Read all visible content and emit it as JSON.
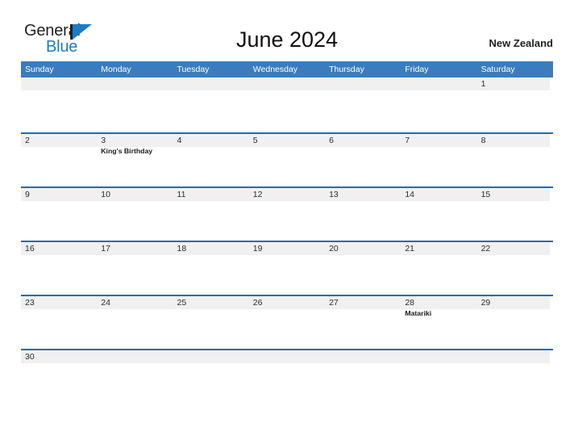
{
  "brand": {
    "name_part1": "General",
    "name_part2": "Blue",
    "triangle_color": "#1a7dc4"
  },
  "header": {
    "title": "June 2024",
    "country": "New Zealand"
  },
  "colors": {
    "header_bar": "#3a7cbe",
    "row_divider": "#1f6cb0",
    "date_band": "#f0f0f0",
    "page_background": "#ffffff"
  },
  "calendar": {
    "weekday_headers": [
      "Sunday",
      "Monday",
      "Tuesday",
      "Wednesday",
      "Thursday",
      "Friday",
      "Saturday"
    ],
    "weeks": [
      {
        "days": [
          {
            "num": "",
            "event": ""
          },
          {
            "num": "",
            "event": ""
          },
          {
            "num": "",
            "event": ""
          },
          {
            "num": "",
            "event": ""
          },
          {
            "num": "",
            "event": ""
          },
          {
            "num": "",
            "event": ""
          },
          {
            "num": "1",
            "event": ""
          }
        ]
      },
      {
        "days": [
          {
            "num": "2",
            "event": ""
          },
          {
            "num": "3",
            "event": "King's Birthday"
          },
          {
            "num": "4",
            "event": ""
          },
          {
            "num": "5",
            "event": ""
          },
          {
            "num": "6",
            "event": ""
          },
          {
            "num": "7",
            "event": ""
          },
          {
            "num": "8",
            "event": ""
          }
        ]
      },
      {
        "days": [
          {
            "num": "9",
            "event": ""
          },
          {
            "num": "10",
            "event": ""
          },
          {
            "num": "11",
            "event": ""
          },
          {
            "num": "12",
            "event": ""
          },
          {
            "num": "13",
            "event": ""
          },
          {
            "num": "14",
            "event": ""
          },
          {
            "num": "15",
            "event": ""
          }
        ]
      },
      {
        "days": [
          {
            "num": "16",
            "event": ""
          },
          {
            "num": "17",
            "event": ""
          },
          {
            "num": "18",
            "event": ""
          },
          {
            "num": "19",
            "event": ""
          },
          {
            "num": "20",
            "event": ""
          },
          {
            "num": "21",
            "event": ""
          },
          {
            "num": "22",
            "event": ""
          }
        ]
      },
      {
        "days": [
          {
            "num": "23",
            "event": ""
          },
          {
            "num": "24",
            "event": ""
          },
          {
            "num": "25",
            "event": ""
          },
          {
            "num": "26",
            "event": ""
          },
          {
            "num": "27",
            "event": ""
          },
          {
            "num": "28",
            "event": "Matariki"
          },
          {
            "num": "29",
            "event": ""
          }
        ]
      },
      {
        "days": [
          {
            "num": "30",
            "event": ""
          },
          {
            "num": "",
            "event": ""
          },
          {
            "num": "",
            "event": ""
          },
          {
            "num": "",
            "event": ""
          },
          {
            "num": "",
            "event": ""
          },
          {
            "num": "",
            "event": ""
          },
          {
            "num": "",
            "event": ""
          }
        ]
      }
    ]
  }
}
